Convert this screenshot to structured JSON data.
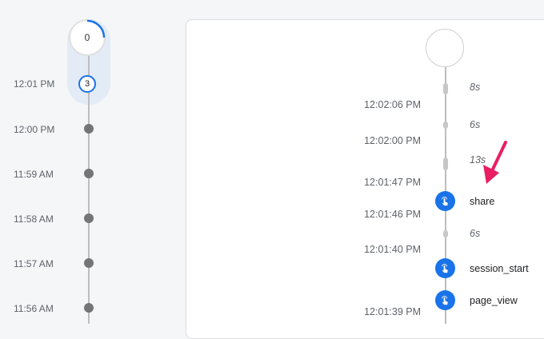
{
  "minutes_timeline": {
    "counter_value": "0",
    "selected_count": "3",
    "times": [
      "12:01 PM",
      "12:00 PM",
      "11:59 AM",
      "11:58 AM",
      "11:57 AM",
      "11:56 AM"
    ]
  },
  "event_stream": {
    "gaps": [
      "8s",
      "6s",
      "13s",
      "6s"
    ],
    "timestamps": [
      "12:02:06 PM",
      "12:02:00 PM",
      "12:01:47 PM",
      "12:01:46 PM",
      "12:01:40 PM",
      "12:01:39 PM"
    ],
    "events": [
      "share",
      "session_start",
      "page_view"
    ],
    "event_icon": "touch-icon"
  },
  "colors": {
    "accent": "#1a73e8",
    "annotation_arrow": "#e91e63",
    "selection_highlight": "#e3ebf6"
  }
}
